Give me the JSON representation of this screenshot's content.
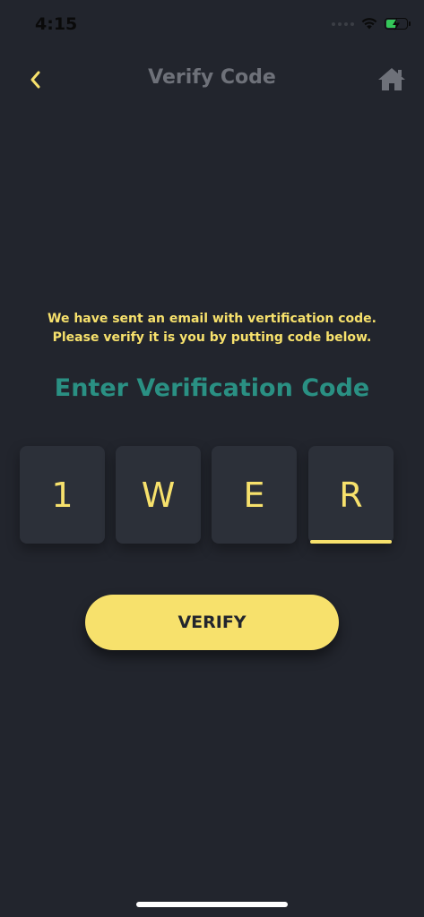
{
  "status_bar": {
    "time": "4:15"
  },
  "nav": {
    "title": "Verify Code"
  },
  "message": "We have sent an email with vertification code. Please verify it is you by putting code below.",
  "section_title": "Enter Verification Code",
  "code": {
    "digits": [
      "1",
      "W",
      "E",
      "R"
    ],
    "active_index": 3
  },
  "verify_label": "VERIFY",
  "colors": {
    "background": "#22252d",
    "accent": "#f7e16c",
    "title": "#2a9083",
    "box": "#2c3039",
    "nav_title": "#6e7179"
  },
  "icons": {
    "back": "chevron-left-icon",
    "home": "home-icon"
  }
}
